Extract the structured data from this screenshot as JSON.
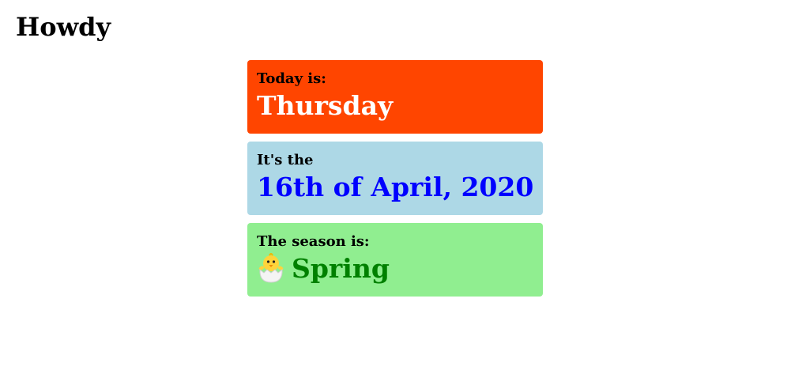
{
  "page": {
    "title": "Howdy"
  },
  "cards": [
    {
      "label": "Today is:",
      "value": "Thursday",
      "background": "#ff4500",
      "value_color": "#ffffff"
    },
    {
      "label": "It's the",
      "value": "16th of April, 2020",
      "background": "#add8e6",
      "value_color": "#0000ff"
    },
    {
      "label": "The season is:",
      "value": "Spring",
      "icon": "hatching-chick-icon",
      "background": "#90ee90",
      "value_color": "#008000"
    }
  ]
}
